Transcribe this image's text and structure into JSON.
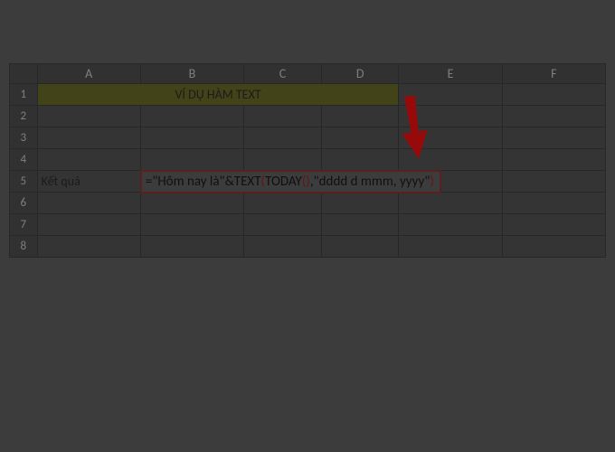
{
  "columns": {
    "A": "A",
    "B": "B",
    "C": "C",
    "D": "D",
    "E": "E",
    "F": "F"
  },
  "rows": {
    "r1": "1",
    "r2": "2",
    "r3": "3",
    "r4": "4",
    "r5": "5",
    "r6": "6",
    "r7": "7",
    "r8": "8"
  },
  "cells": {
    "title": "VÍ DỤ HÀM TEXT",
    "a5_label": "Kết quả"
  },
  "formula": {
    "full": "=\"Hôm nay là\"&TEXT(TODAY(),\"dddd d mmm, yyyy\")",
    "p1": "=\"Hôm nay là\"&TEXT",
    "p2": "(",
    "p3": "TODAY",
    "p4": "()",
    "p5": ",\"dddd d mmm, yyyy\"",
    "p6": ")"
  },
  "annotation": {
    "arrow_color": "#d10000"
  }
}
